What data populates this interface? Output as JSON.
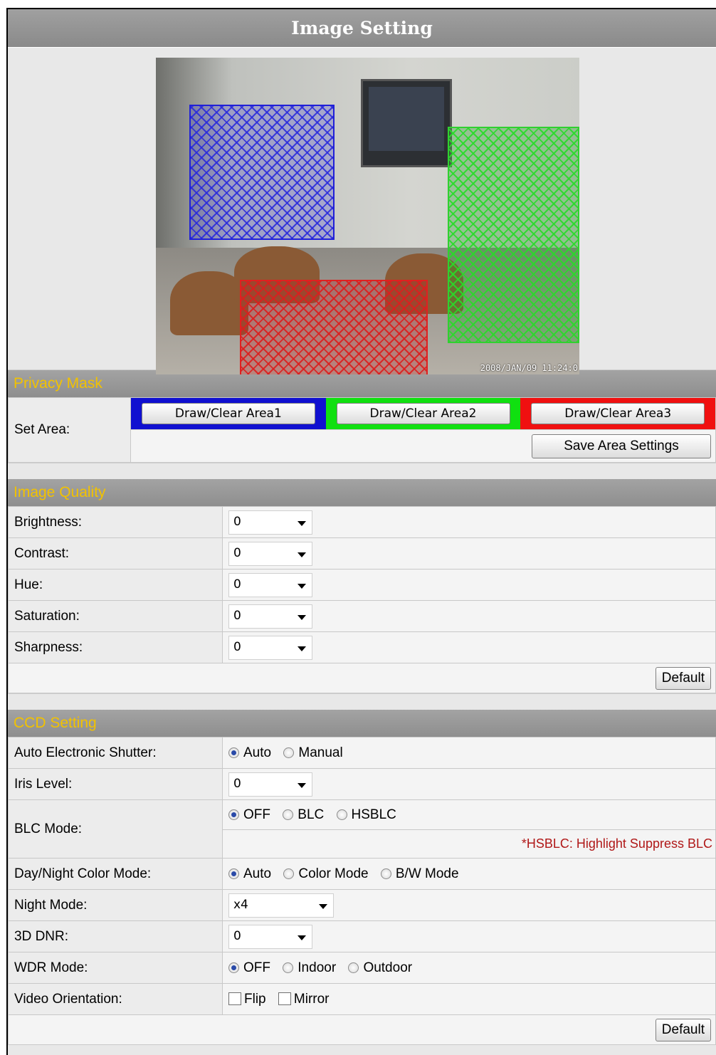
{
  "title": "Image Setting",
  "video": {
    "timestamp": "2008/JAN/09 11:24:0"
  },
  "privacy_mask": {
    "header": "Privacy Mask",
    "set_area_label": "Set Area:",
    "area1_label": "Draw/Clear Area1",
    "area2_label": "Draw/Clear Area2",
    "area3_label": "Draw/Clear Area3",
    "area_colors": [
      "#1010d0",
      "#10e010",
      "#f01010"
    ],
    "save_label": "Save Area Settings"
  },
  "image_quality": {
    "header": "Image Quality",
    "rows": [
      {
        "label": "Brightness:",
        "value": "0"
      },
      {
        "label": "Contrast:",
        "value": "0"
      },
      {
        "label": "Hue:",
        "value": "0"
      },
      {
        "label": "Saturation:",
        "value": "0"
      },
      {
        "label": "Sharpness:",
        "value": "0"
      }
    ],
    "default_label": "Default"
  },
  "ccd_setting": {
    "header": "CCD Setting",
    "shutter": {
      "label": "Auto Electronic Shutter:",
      "options": [
        "Auto",
        "Manual"
      ],
      "selected": "Auto"
    },
    "iris": {
      "label": "Iris Level:",
      "value": "0"
    },
    "blc": {
      "label": "BLC Mode:",
      "options": [
        "OFF",
        "BLC",
        "HSBLC"
      ],
      "selected": "OFF",
      "note": "*HSBLC: Highlight Suppress BLC"
    },
    "daynight": {
      "label": "Day/Night Color Mode:",
      "options": [
        "Auto",
        "Color Mode",
        "B/W Mode"
      ],
      "selected": "Auto"
    },
    "night": {
      "label": "Night Mode:",
      "value": "x4"
    },
    "dnr": {
      "label": "3D DNR:",
      "value": "0"
    },
    "wdr": {
      "label": "WDR Mode:",
      "options": [
        "OFF",
        "Indoor",
        "Outdoor"
      ],
      "selected": "OFF"
    },
    "orientation": {
      "label": "Video Orientation:",
      "options": [
        "Flip",
        "Mirror"
      ],
      "checked": []
    },
    "default_label": "Default"
  },
  "colors": {
    "header_bg": "#969696",
    "section_text": "#f2c200",
    "note_text": "#b01818"
  }
}
